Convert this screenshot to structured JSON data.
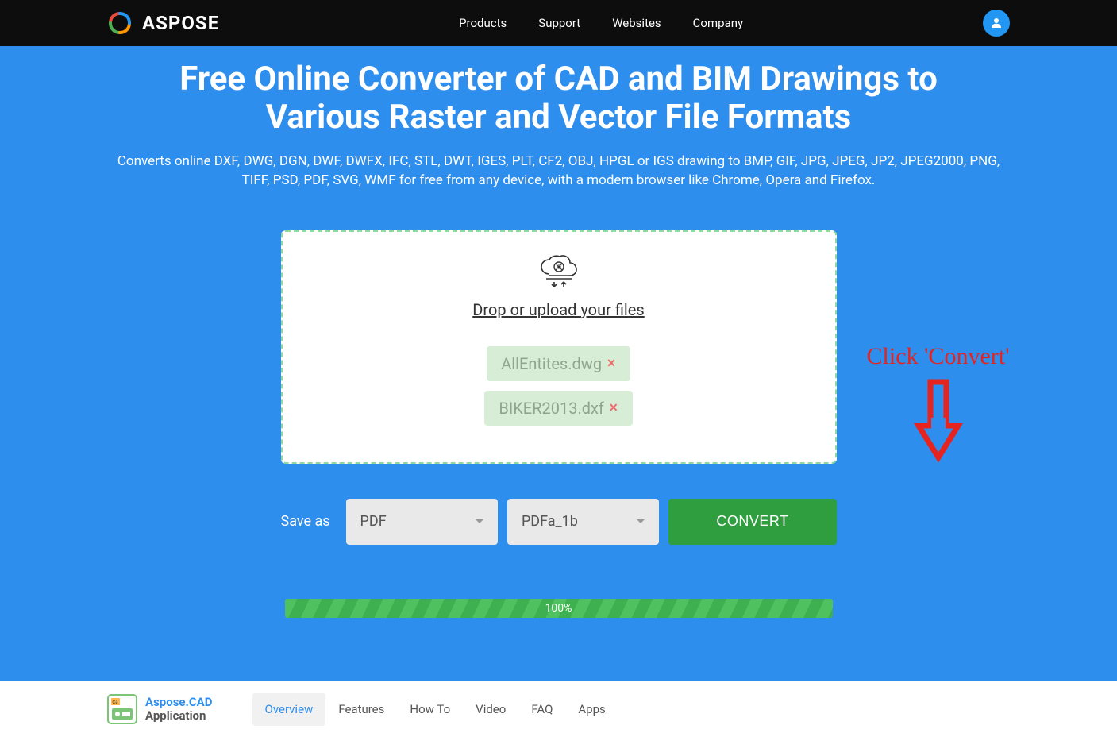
{
  "header": {
    "brand": "ASPOSE",
    "nav": [
      "Products",
      "Support",
      "Websites",
      "Company"
    ]
  },
  "hero": {
    "title": "Free Online Converter of CAD and BIM Drawings to Various Raster and Vector File Formats",
    "subtitle": "Converts online DXF, DWG, DGN, DWF, DWFX, IFC, STL, DWT, IGES, PLT, CF2, OBJ, HPGL or IGS drawing to BMP, GIF, JPG, JPEG, JP2, JPEG2000, PNG, TIFF, PSD, PDF, SVG, WMF for free from any device, with a modern browser like Chrome, Opera and Firefox."
  },
  "dropzone": {
    "label": "Drop or upload your files",
    "files": [
      "AllEntites.dwg",
      "BIKER2013.dxf"
    ]
  },
  "annotation": {
    "text": "Click 'Convert'"
  },
  "controls": {
    "save_as_label": "Save as",
    "format_value": "PDF",
    "subformat_value": "PDFa_1b",
    "convert_label": "CONVERT"
  },
  "progress": {
    "percent_label": "100%"
  },
  "bottom": {
    "app_name_top": "Aspose.CAD",
    "app_name_bot": "Application",
    "tabs": [
      "Overview",
      "Features",
      "How To",
      "Video",
      "FAQ",
      "Apps"
    ],
    "active_tab_index": 0
  }
}
